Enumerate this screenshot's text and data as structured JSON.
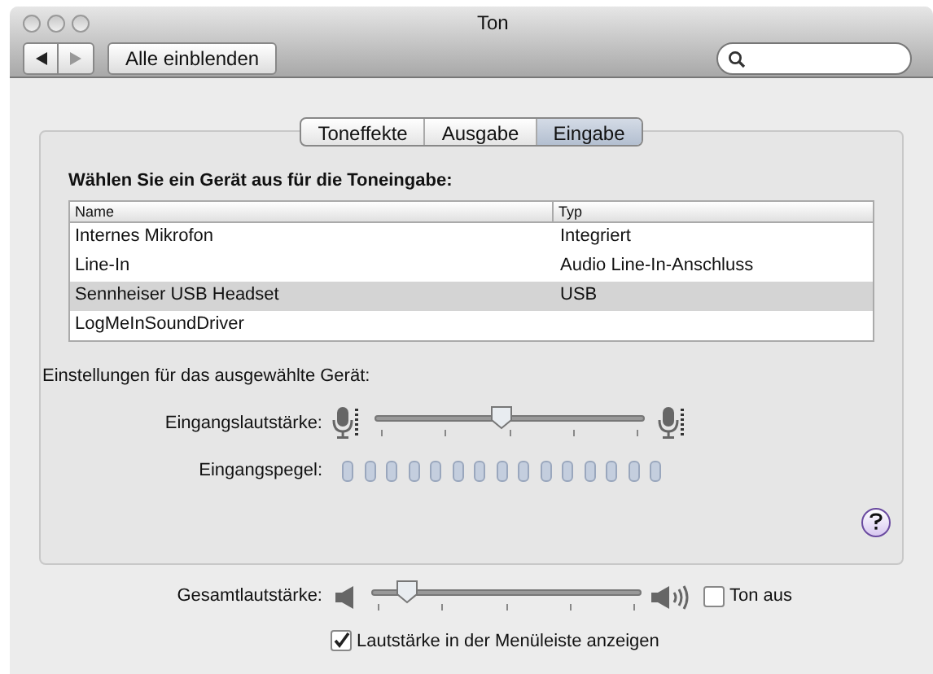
{
  "window": {
    "title": "Ton"
  },
  "toolbar": {
    "show_all": "Alle einblenden"
  },
  "tabs": [
    {
      "label": "Toneffekte",
      "selected": false
    },
    {
      "label": "Ausgabe",
      "selected": false
    },
    {
      "label": "Eingabe",
      "selected": true
    }
  ],
  "device_heading": "Wählen Sie ein Gerät aus für die Toneingabe:",
  "table": {
    "columns": [
      "Name",
      "Typ"
    ],
    "rows": [
      {
        "cells": [
          "Internes Mikrofon",
          "Integriert"
        ],
        "selected": false
      },
      {
        "cells": [
          "Line-In",
          "Audio Line-In-Anschluss"
        ],
        "selected": false
      },
      {
        "cells": [
          "Sennheiser USB Headset",
          "USB"
        ],
        "selected": true
      },
      {
        "cells": [
          "LogMeInSoundDriver"
        ],
        "selected": false
      }
    ]
  },
  "settings_heading": "Einstellungen für das ausgewählte Gerät:",
  "input_volume": {
    "label": "Eingangslautstärke:",
    "level": 0.47
  },
  "input_level": {
    "label": "Eingangspegel:"
  },
  "output_volume": {
    "label": "Gesamtlautstärke:",
    "level": 0.1
  },
  "mute": {
    "label": "Ton aus",
    "checked": false
  },
  "menubar": {
    "label": "Lautstärke in der Menüleiste anzeigen",
    "checked": true
  }
}
